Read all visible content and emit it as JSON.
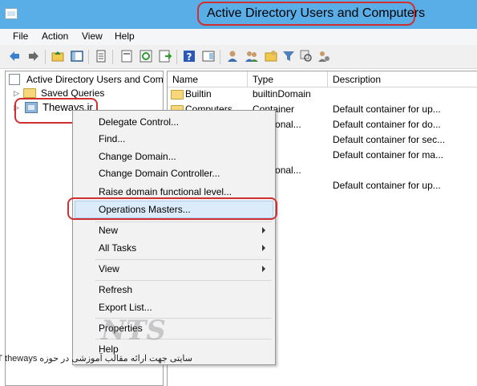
{
  "window": {
    "title": "Active Directory Users and Computers"
  },
  "menubar": {
    "items": [
      "File",
      "Action",
      "View",
      "Help"
    ]
  },
  "toolbar": {
    "icons": [
      "back-arrow-icon",
      "forward-arrow-icon",
      "up-folder-icon",
      "show-tree-icon",
      "properties-icon",
      "export-icon",
      "refresh-icon",
      "export-list-icon",
      "help-icon",
      "console-tree-icon",
      "user-icon",
      "group-icon",
      "ou-icon",
      "filter-icon",
      "find-icon",
      "add-to-group-icon"
    ]
  },
  "tree": {
    "root": "Active Directory Users and Com",
    "saved_queries": "Saved Queries",
    "domain": "Theways.ir"
  },
  "list": {
    "columns": [
      "Name",
      "Type",
      "Description"
    ],
    "rows": [
      {
        "name": "Builtin",
        "type": "builtinDomain",
        "description": ""
      },
      {
        "name": "Computers",
        "type": "Container",
        "description": "Default container for up..."
      },
      {
        "name": "",
        "type": "nizational...",
        "description": "Default container for do..."
      },
      {
        "name": "",
        "type": "iner",
        "description": "Default container for sec..."
      },
      {
        "name": "",
        "type": "iner",
        "description": "Default container for ma..."
      },
      {
        "name": "",
        "type": "nizational...",
        "description": ""
      },
      {
        "name": "",
        "type": "iner",
        "description": "Default container for up..."
      }
    ]
  },
  "context_menu": {
    "items": {
      "delegate": "Delegate Control...",
      "find": "Find...",
      "change_domain": "Change Domain...",
      "change_dc": "Change Domain Controller...",
      "raise": "Raise domain functional level...",
      "operations": "Operations Masters...",
      "new": "New",
      "all_tasks": "All Tasks",
      "view": "View",
      "refresh": "Refresh",
      "export": "Export List...",
      "properties": "Properties",
      "help": "Help"
    },
    "highlighted": "Operations Masters..."
  },
  "watermark": {
    "text": "سایتی جهت ارائه مقالب آموزشی در حوزه IT theways."
  },
  "colors": {
    "titlebar": "#5aaee8",
    "annotation_ring": "#d03030",
    "highlight": "#dcebfa"
  }
}
